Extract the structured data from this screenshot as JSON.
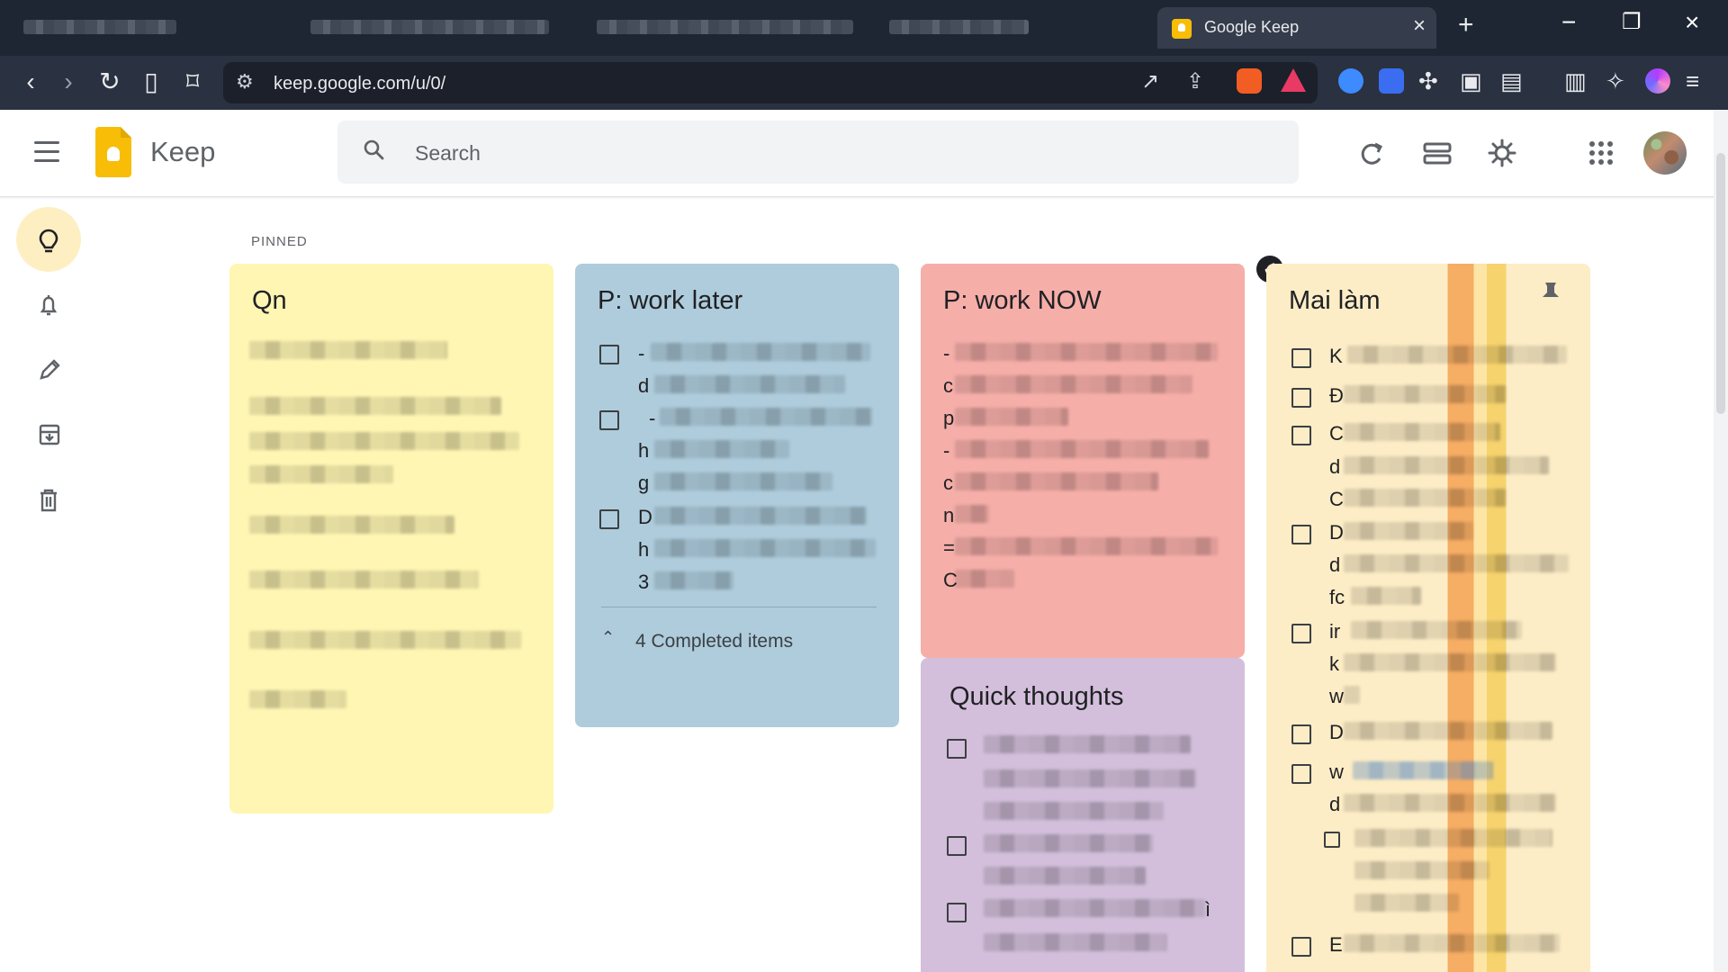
{
  "browser": {
    "active_tab_title": "Google Keep",
    "tab_close": "×",
    "new_tab": "+",
    "minimize": "−",
    "restore": "❐",
    "close": "×",
    "url": "keep.google.com/u/0/"
  },
  "keep": {
    "app_name": "Keep",
    "search_placeholder": "Search",
    "section_label": "PINNED",
    "sidebar_icons": [
      "lightbulb-icon",
      "bell-icon",
      "pencil-icon",
      "archive-icon",
      "trash-icon"
    ],
    "notes": [
      {
        "title": "Qn",
        "color": "#fff6b3"
      },
      {
        "title": "P: work later",
        "color": "#aeccdc",
        "completed": "4 Completed items"
      },
      {
        "title": "P: work NOW",
        "color": "#f6aea9"
      },
      {
        "title": "Quick thoughts",
        "color": "#d3bfdb"
      },
      {
        "title": "Mai làm",
        "color": "#fdedc6"
      }
    ]
  },
  "visible_fragments": {
    "work_later": [
      "-",
      "d",
      "-",
      "h",
      "g",
      "D",
      "h",
      "3"
    ],
    "work_now": [
      "-",
      "c",
      "p",
      "-",
      "c",
      "n",
      "=",
      "C"
    ],
    "mai_lam": [
      "K",
      "Đ",
      "C",
      "d",
      "C",
      "D",
      "d",
      "fc",
      "ir",
      "k",
      "w",
      "D",
      "w",
      "d",
      "E"
    ],
    "quick_thoughts": [
      "ì"
    ]
  }
}
